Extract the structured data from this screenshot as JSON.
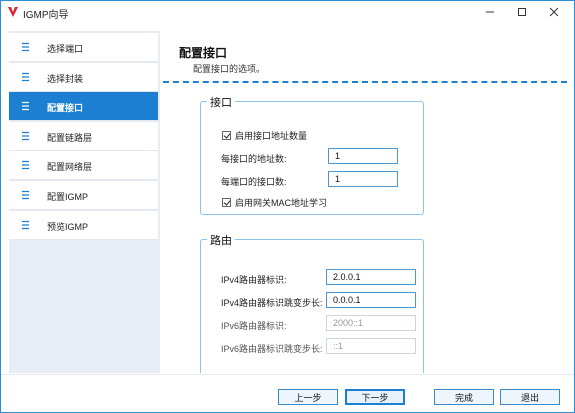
{
  "window": {
    "title": "IGMP向导"
  },
  "sidebar": {
    "items": [
      {
        "label": "选择端口"
      },
      {
        "label": "选择封装"
      },
      {
        "label": "配置接口"
      },
      {
        "label": "配置链路层"
      },
      {
        "label": "配置网络层"
      },
      {
        "label": "配置IGMP"
      },
      {
        "label": "预览IGMP"
      }
    ],
    "active_index": 2
  },
  "page": {
    "title": "配置接口",
    "subtitle": "配置接口的选项。"
  },
  "interface_group": {
    "title": "接口",
    "enable_addr_count": {
      "label": "启用接口地址数量",
      "checked": true
    },
    "addr_per_interface": {
      "label": "每接口的地址数:",
      "value": "1"
    },
    "interfaces_per_port": {
      "label": "每端口的接口数:",
      "value": "1"
    },
    "enable_gateway_mac": {
      "label": "启用网关MAC地址学习",
      "checked": true
    }
  },
  "routing_group": {
    "title": "路由",
    "ipv4_router_id": {
      "label": "IPv4路由器标识:",
      "value": "2.0.0.1"
    },
    "ipv4_router_id_step": {
      "label": "IPv4路由器标识跳变步长:",
      "value": "0.0.0.1"
    },
    "ipv6_router_id": {
      "label": "IPv6路由器标识:",
      "value": "2000::1"
    },
    "ipv6_router_id_step": {
      "label": "IPv6路由器标识跳变步长:",
      "value": "::1"
    }
  },
  "footer": {
    "prev_label": "上一步",
    "next_label": "下一步",
    "finish_label": "完成",
    "exit_label": "退出"
  },
  "colors": {
    "accent": "#1d7fd1",
    "sidebar_bg": "#e8edf5",
    "group_border": "#8cc3ea"
  }
}
